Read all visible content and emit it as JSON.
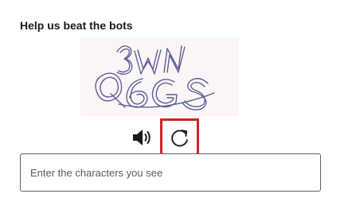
{
  "challenge": {
    "heading": "Help us beat the bots",
    "captcha_text": "3WN Q6GS",
    "captcha_ink_color": "#5b5f97",
    "captcha_bg_color": "#fcf5f7",
    "audio_icon": "speaker-icon",
    "refresh_icon": "refresh-icon",
    "highlight_color": "#d0262b"
  },
  "answer": {
    "placeholder": "Enter the characters you see",
    "value": ""
  }
}
